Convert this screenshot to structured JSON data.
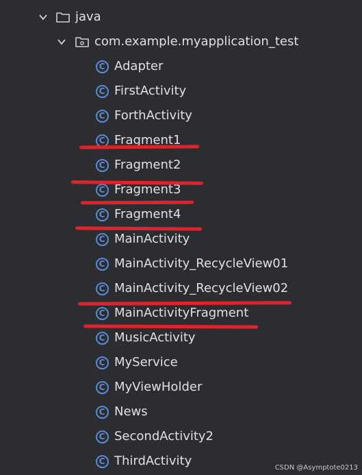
{
  "tree": {
    "java_label": "java",
    "package_label": "com.example.myapplication_test",
    "classes": [
      "Adapter",
      "FirstActivity",
      "ForthActivity",
      "Fragment1",
      "Fragment2",
      "Fragment3",
      "Fragment4",
      "MainActivity",
      "MainActivity_RecycleView01",
      "MainActivity_RecycleView02",
      "MainActivityFragment",
      "MusicActivity",
      "MyService",
      "MyViewHolder",
      "News",
      "SecondActivity2",
      "ThirdActivity"
    ],
    "class_icon_glyph": "C"
  },
  "icons": {
    "expand": "chevron-down-icon",
    "java_folder": "folder-icon",
    "package": "package-folder-icon",
    "class": "class-icon"
  },
  "annotation_color": "#e0232b",
  "class_icon_color": "#5a8bd6",
  "watermark": "CSDN @Asymptote0213"
}
